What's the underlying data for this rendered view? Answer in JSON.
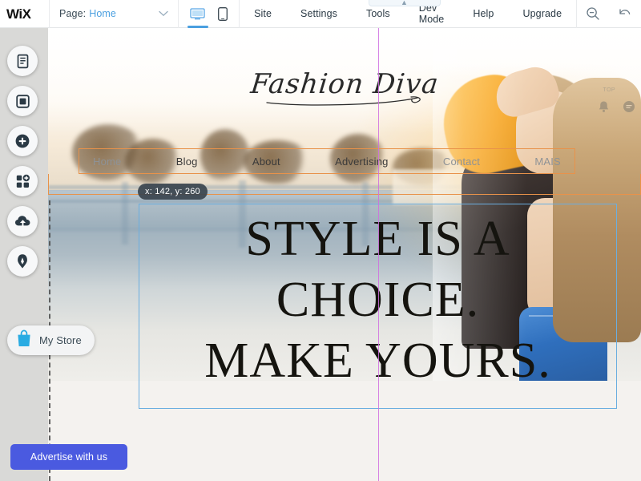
{
  "topbar": {
    "logo": "WIX",
    "page_label": "Page:",
    "page_value": "Home",
    "chevron_icon": "chevron-down-icon",
    "devices": [
      {
        "name": "desktop",
        "icon": "desktop-icon",
        "active": true
      },
      {
        "name": "mobile",
        "icon": "mobile-icon",
        "active": false
      }
    ],
    "menu": [
      {
        "label": "Site"
      },
      {
        "label": "Settings"
      },
      {
        "label": "Tools"
      },
      {
        "label": "Dev Mode"
      },
      {
        "label": "Help"
      },
      {
        "label": "Upgrade"
      }
    ],
    "tools": [
      {
        "name": "zoom-out-icon"
      },
      {
        "name": "undo-icon"
      }
    ]
  },
  "left_rail": {
    "buttons": [
      {
        "name": "menus-and-pages-icon",
        "title": "Menus & Pages"
      },
      {
        "name": "background-icon",
        "title": "Background"
      },
      {
        "name": "add-icon",
        "title": "Add"
      },
      {
        "name": "add-apps-icon",
        "title": "Add Apps"
      },
      {
        "name": "my-uploads-icon",
        "title": "My Uploads"
      },
      {
        "name": "blog-icon",
        "title": "Blog"
      }
    ],
    "store": {
      "label": "My Store",
      "icon": "shopping-bag-icon",
      "icon_color": "#29ABE2"
    }
  },
  "canvas": {
    "coordinate_tooltip": "x: 142, y: 260",
    "site": {
      "logo_text": "Fashion Diva",
      "nav": [
        {
          "label": "Home",
          "dim": true
        },
        {
          "label": "Blog",
          "dim": false
        },
        {
          "label": "About",
          "dim": false
        },
        {
          "label": "Advertising",
          "dim": false
        },
        {
          "label": "Contact",
          "dim": true
        },
        {
          "label": "MAIS",
          "dim": true
        }
      ],
      "headline": [
        "STYLE IS A",
        "CHOICE.",
        "MAKE YOURS."
      ],
      "widgets": [
        {
          "name": "top-label",
          "label": "TOP"
        },
        {
          "name": "notification-bell-icon"
        },
        {
          "name": "chat-bubble-icon"
        }
      ]
    },
    "advertise_button": "Advertise with us"
  },
  "colors": {
    "accent_blue": "#4a9fe0",
    "selection_blue": "#6aaee0",
    "component_orange": "#e8924a",
    "guide_magenta": "#d06fe0",
    "advertise_blue": "#4a5ae0",
    "store_icon_blue": "#29ABE2"
  }
}
